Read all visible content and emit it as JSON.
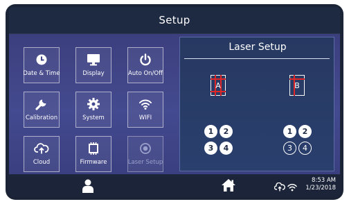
{
  "header": {
    "title": "Setup"
  },
  "tiles": [
    {
      "label": "Date & Time",
      "icon": "clock-icon"
    },
    {
      "label": "Display",
      "icon": "monitor-icon"
    },
    {
      "label": "Auto On/Off",
      "icon": "power-icon"
    },
    {
      "label": "Calibration",
      "icon": "wrench-icon"
    },
    {
      "label": "System",
      "icon": "gear-icon"
    },
    {
      "label": "WIFI",
      "icon": "wifi-icon"
    },
    {
      "label": "Cloud",
      "icon": "cloud-icon"
    },
    {
      "label": "Firmware",
      "icon": "chip-icon"
    },
    {
      "label": "Laser Setup",
      "icon": "target-icon",
      "state": "disabled"
    }
  ],
  "laser_panel": {
    "title": "Laser Setup",
    "sheet_a": {
      "label": "A"
    },
    "sheet_b": {
      "label": "B"
    },
    "group_a": [
      "1",
      "2",
      "3",
      "4"
    ],
    "group_b": [
      "1",
      "2",
      "3",
      "4"
    ]
  },
  "footer": {
    "time": "8:53 AM",
    "date": "1/23/2018"
  },
  "colors": {
    "accent_red": "#e02626",
    "tile_bg": "#444a8f"
  }
}
